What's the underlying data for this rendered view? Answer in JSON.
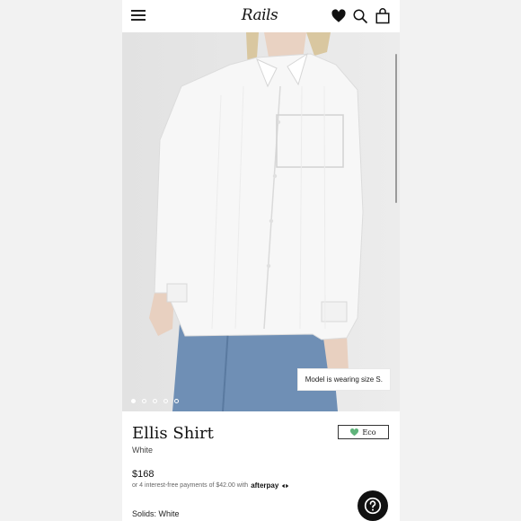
{
  "header": {
    "logo_text": "Rails",
    "menu_icon": "hamburger-menu-icon",
    "icons": [
      "heart-icon",
      "search-icon",
      "shopping-bag-icon"
    ]
  },
  "gallery": {
    "model_note": "Model is wearing size S.",
    "dot_count": 5,
    "active_index": 0
  },
  "product": {
    "name": "Ellis Shirt",
    "color": "White",
    "badge": "Eco",
    "price": "$168",
    "installments": "or 4 interest-free payments of $42.00 with",
    "afterpay_label": "afterpay",
    "option_line": "Solids: White"
  },
  "help_icon": "question-mark-icon",
  "colors": {
    "eco_leaf": "#5fb37a",
    "text": "#111111",
    "help_button": "#111111"
  }
}
